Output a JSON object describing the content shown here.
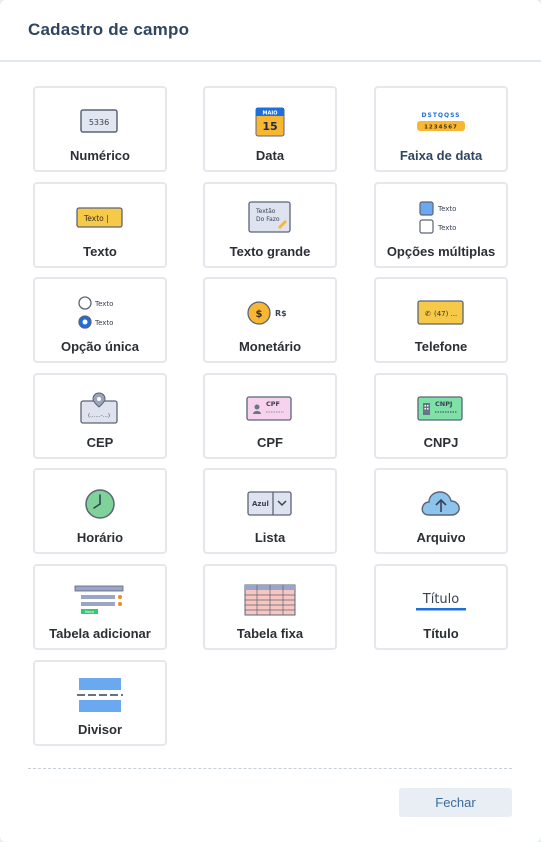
{
  "modal": {
    "title": "Cadastro de campo",
    "close_label": "Fechar"
  },
  "icon_text": {
    "numeric_value": "5336",
    "date_month": "MAIO",
    "date_day": "15",
    "range_letters": "DSTQQSS",
    "range_digits": "1234567",
    "text_sample": "Texto |",
    "textarea_line1": "Textão",
    "textarea_line2": "Do Fazo",
    "option_text": "Texto",
    "currency_symbol": "$",
    "currency_code": "R$",
    "phone_text": "(47) ...",
    "cep_text": "(......-...)",
    "cpf_text": "CPF",
    "cnpj_text": "CNPJ",
    "list_value": "Azul",
    "add_table_button": "Novo",
    "title_sample": "Título"
  },
  "fields": [
    {
      "label": "Numérico",
      "icon": "numeric-icon"
    },
    {
      "label": "Data",
      "icon": "calendar-icon"
    },
    {
      "label": "Faixa de data",
      "icon": "date-range-icon"
    },
    {
      "label": "Texto",
      "icon": "text-input-icon"
    },
    {
      "label": "Texto grande",
      "icon": "textarea-icon"
    },
    {
      "label": "Opções múltiplas",
      "icon": "checkbox-icon"
    },
    {
      "label": "Opção única",
      "icon": "radio-icon"
    },
    {
      "label": "Monetário",
      "icon": "coin-icon"
    },
    {
      "label": "Telefone",
      "icon": "phone-icon"
    },
    {
      "label": "CEP",
      "icon": "map-pin-icon"
    },
    {
      "label": "CPF",
      "icon": "id-card-icon"
    },
    {
      "label": "CNPJ",
      "icon": "company-card-icon"
    },
    {
      "label": "Horário",
      "icon": "clock-icon"
    },
    {
      "label": "Lista",
      "icon": "dropdown-icon"
    },
    {
      "label": "Arquivo",
      "icon": "cloud-upload-icon"
    },
    {
      "label": "Tabela adicionar",
      "icon": "add-table-icon"
    },
    {
      "label": "Tabela fixa",
      "icon": "fixed-table-icon"
    },
    {
      "label": "Título",
      "icon": "title-icon"
    },
    {
      "label": "Divisor",
      "icon": "divider-icon"
    }
  ],
  "colors": {
    "title": "#2e4660",
    "accent_blue": "#1e6fd9",
    "accent_yellow": "#f7c948",
    "button_bg": "#e9eef4",
    "button_text": "#3b6d9e"
  }
}
